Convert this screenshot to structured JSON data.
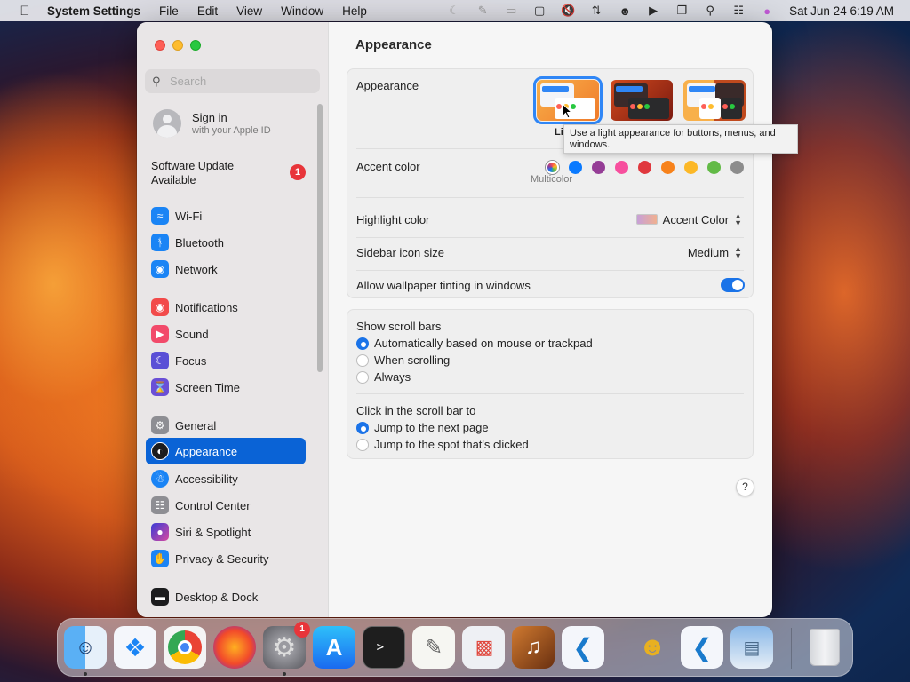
{
  "menubar": {
    "apple_icon": "apple-logo-icon",
    "items": [
      "System Settings",
      "File",
      "Edit",
      "View",
      "Window",
      "Help"
    ],
    "clock": "Sat Jun 24  6:19 AM",
    "status_icons": [
      "moon-icon",
      "pen-off-icon",
      "screen-mirror-icon",
      "display-icon",
      "mute-icon",
      "network-icon",
      "user-circle-icon",
      "play-circle-icon",
      "window-stack-icon",
      "search-icon",
      "control-center-icon",
      "siri-icon"
    ]
  },
  "sidebar": {
    "search_placeholder": "Search",
    "account": {
      "title": "Sign in",
      "subtitle": "with your Apple ID"
    },
    "update": {
      "label": "Software Update Available",
      "badge": "1"
    },
    "items": [
      {
        "label": "Wi-Fi",
        "icon": "wifi-icon",
        "color": "#1a84f5"
      },
      {
        "label": "Bluetooth",
        "icon": "bluetooth-icon",
        "color": "#1a84f5"
      },
      {
        "label": "Network",
        "icon": "globe-icon",
        "color": "#1a84f5"
      },
      {
        "label": "Notifications",
        "icon": "bell-icon",
        "color": "#f24a4a"
      },
      {
        "label": "Sound",
        "icon": "speaker-icon",
        "color": "#f24a6a"
      },
      {
        "label": "Focus",
        "icon": "moon-icon",
        "color": "#5a4fd6"
      },
      {
        "label": "Screen Time",
        "icon": "hourglass-icon",
        "color": "#6a4fd6"
      },
      {
        "label": "General",
        "icon": "gear-icon",
        "color": "#8e8e93"
      },
      {
        "label": "Appearance",
        "icon": "appearance-icon",
        "color": "#1c1c1e"
      },
      {
        "label": "Accessibility",
        "icon": "accessibility-icon",
        "color": "#1a84f5"
      },
      {
        "label": "Control Center",
        "icon": "toggles-icon",
        "color": "#8e8e93"
      },
      {
        "label": "Siri & Spotlight",
        "icon": "siri-icon",
        "color": "#7a4fd6"
      },
      {
        "label": "Privacy & Security",
        "icon": "hand-icon",
        "color": "#1a84f5"
      },
      {
        "label": "Desktop & Dock",
        "icon": "dock-icon",
        "color": "#1c1c1e"
      }
    ]
  },
  "main": {
    "title": "Appearance",
    "appearance_label": "Appearance",
    "appearance_selected_label": "Li",
    "tooltip": "Use a light appearance for buttons, menus, and windows.",
    "accent_label": "Accent color",
    "accent_selected_label": "Multicolor",
    "accent_colors": [
      "#8e5ad6",
      "#0a7aff",
      "#953d96",
      "#f74f9e",
      "#e0383e",
      "#f7821b",
      "#fcb827",
      "#62ba46",
      "#8c8c8c"
    ],
    "highlight_label": "Highlight color",
    "highlight_value": "Accent Color",
    "sidebar_icon_label": "Sidebar icon size",
    "sidebar_icon_value": "Medium",
    "tinting_label": "Allow wallpaper tinting in windows",
    "tinting_on": true,
    "scroll_label": "Show scroll bars",
    "scroll_options": [
      "Automatically based on mouse or trackpad",
      "When scrolling",
      "Always"
    ],
    "scroll_selected": 0,
    "click_label": "Click in the scroll bar to",
    "click_options": [
      "Jump to the next page",
      "Jump to the spot that's clicked"
    ],
    "click_selected": 0,
    "help": "?"
  },
  "dock": {
    "apps": [
      "finder-icon",
      "safari-icon",
      "chrome-icon",
      "firefox-icon",
      "system-settings-icon",
      "app-store-icon",
      "terminal-icon",
      "textedit-icon",
      "launchpad-icon",
      "guitar-icon",
      "vscode-icon",
      "bee-icon",
      "vscode-icon",
      "preview-icon",
      "trash-icon"
    ],
    "settings_badge": "1"
  }
}
